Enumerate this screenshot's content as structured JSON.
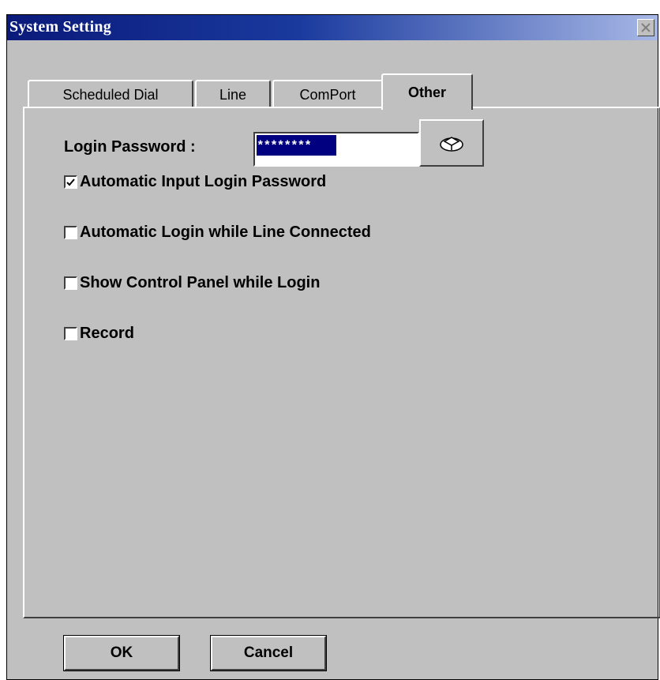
{
  "window": {
    "title": "System Setting"
  },
  "tabs": [
    {
      "label": "Scheduled Dial",
      "active": false
    },
    {
      "label": "Line",
      "active": false
    },
    {
      "label": "ComPort",
      "active": false
    },
    {
      "label": "Other",
      "active": true
    }
  ],
  "login": {
    "label": "Login Password :",
    "value": "********",
    "key_button_icon": "key-icon"
  },
  "options": [
    {
      "label": "Automatic Input Login Password",
      "checked": true
    },
    {
      "label": "Automatic Login while Line Connected",
      "checked": false
    },
    {
      "label": "Show Control Panel while Login",
      "checked": false
    },
    {
      "label": "Record",
      "checked": false
    }
  ],
  "buttons": {
    "ok": "OK",
    "cancel": "Cancel"
  },
  "colors": {
    "titlebar_start": "#0a1a7a",
    "titlebar_end": "#a7b8e6",
    "face": "#c0c0c0",
    "selection": "#000080"
  }
}
